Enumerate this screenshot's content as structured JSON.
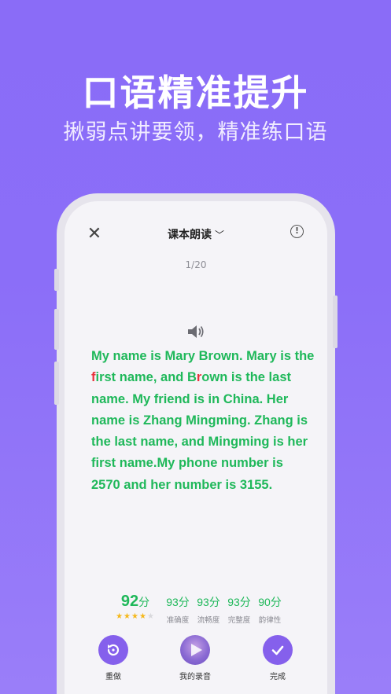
{
  "hero": {
    "title": "口语精准提升",
    "subtitle": "揪弱点讲要领，精准练口语"
  },
  "header": {
    "title": "课本朗读",
    "close_icon": "close-icon",
    "dropdown_icon": "chevron-down-icon",
    "info_icon": "info-icon"
  },
  "progress": "1/20",
  "passage": {
    "segments": [
      {
        "text": "My name is Mary Brown. Mary is the ",
        "highlight": false
      },
      {
        "text": "f",
        "highlight": true
      },
      {
        "text": "irst name, and B",
        "highlight": false
      },
      {
        "text": "r",
        "highlight": true
      },
      {
        "text": "own is the last name. My friend is in China. Her name is Zhang Mingming. Zhang is the last name, and Mingming is her first name.My phone number is 2570 and her number is 3155.",
        "highlight": false
      }
    ]
  },
  "scores": {
    "total": "92",
    "total_unit": "分",
    "stars": 4,
    "stars_max": 5,
    "metrics": [
      {
        "value": "93分",
        "label": "准确度"
      },
      {
        "value": "93分",
        "label": "流畅度"
      },
      {
        "value": "93分",
        "label": "完整度"
      },
      {
        "value": "90分",
        "label": "韵律性"
      }
    ]
  },
  "actions": [
    {
      "label": "重做",
      "icon": "redo-icon"
    },
    {
      "label": "我的录音",
      "icon": "play-icon"
    },
    {
      "label": "完成",
      "icon": "check-icon"
    }
  ],
  "colors": {
    "background": "#8a6cf7",
    "accent": "#8560ec",
    "text_green": "#1fb85a",
    "highlight_red": "#e8323c",
    "star": "#f5b81c"
  }
}
